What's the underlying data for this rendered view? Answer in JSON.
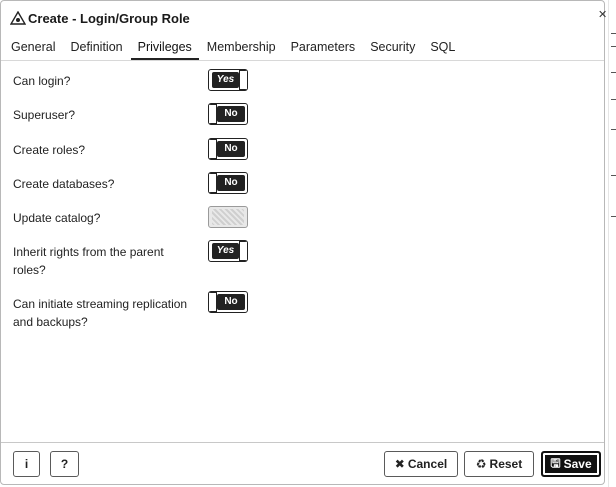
{
  "dialog": {
    "title": "Create - Login/Group Role",
    "title_icon": "role-icon"
  },
  "tabs": [
    {
      "label": "General"
    },
    {
      "label": "Definition"
    },
    {
      "label": "Privileges",
      "active": true
    },
    {
      "label": "Membership"
    },
    {
      "label": "Parameters"
    },
    {
      "label": "Security"
    },
    {
      "label": "SQL"
    }
  ],
  "privileges": [
    {
      "label": "Can login?",
      "state": "Yes"
    },
    {
      "label": "Superuser?",
      "state": "No"
    },
    {
      "label": "Create roles?",
      "state": "No"
    },
    {
      "label": "Create databases?",
      "state": "No"
    },
    {
      "label": "Update catalog?",
      "state": ""
    },
    {
      "label": "Inherit rights from the parent roles?",
      "state": "Yes"
    },
    {
      "label": "Can initiate streaming replication and backups?",
      "state": "No"
    }
  ],
  "footer": {
    "info_label": "i",
    "help_label": "?",
    "cancel_label": "Cancel",
    "reset_label": "Reset",
    "save_label": "Save"
  },
  "colors": {
    "accent": "#111111",
    "border": "#b8b8b8"
  }
}
